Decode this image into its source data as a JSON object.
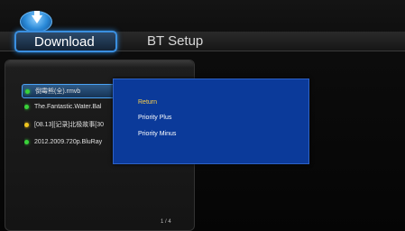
{
  "header": {
    "tabs": [
      {
        "label": "Download",
        "active": true
      },
      {
        "label": "BT Setup",
        "active": false
      }
    ],
    "logo_icon": "download-arrow-icon"
  },
  "file_list": {
    "items": [
      {
        "name": "倒霉熊(全).rmvb",
        "status": "green",
        "selected": true
      },
      {
        "name": "The.Fantastic.Water.Bal",
        "status": "green",
        "selected": false
      },
      {
        "name": "[08.13][记录]北极故事[30",
        "status": "yellow",
        "selected": false
      },
      {
        "name": "2012.2009.720p.BluRay",
        "status": "green",
        "selected": false
      }
    ],
    "page_indicator": "1 / 4"
  },
  "context_menu": {
    "items": [
      {
        "label": "Return",
        "active": true
      },
      {
        "label": "Priority Plus",
        "active": false
      },
      {
        "label": "Priority Minus",
        "active": false
      }
    ]
  },
  "colors": {
    "accent": "#3a8fe0",
    "menu_bg": "#0b3a9a",
    "active_text": "#ffd24a",
    "status_green": "#39d23a",
    "status_yellow": "#f0c51e"
  }
}
